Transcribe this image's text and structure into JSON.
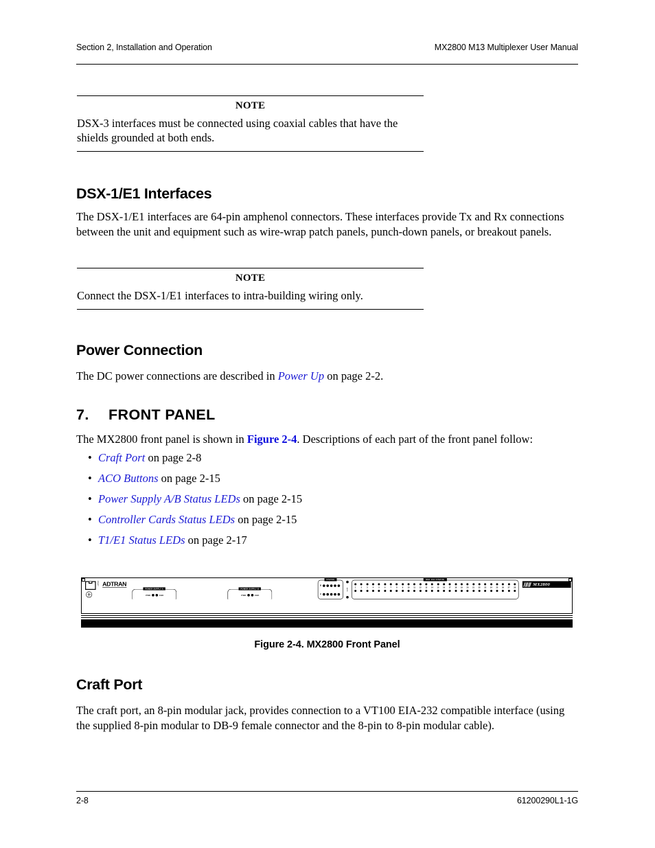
{
  "header": {
    "left": "Section 2, Installation and Operation",
    "right": "MX2800 M13 Multiplexer User Manual"
  },
  "footer": {
    "page_number": "2-8",
    "doc_number": "61200290L1-1G"
  },
  "notes": [
    {
      "title": "NOTE",
      "body": "DSX-3 interfaces must be connected using coaxial cables that have the shields grounded at both ends."
    },
    {
      "title": "NOTE",
      "body": "Connect the DSX-1/E1 interfaces to intra-building wiring only."
    }
  ],
  "sections": {
    "dsx1e1": {
      "heading": "DSX-1/E1 Interfaces",
      "paragraph": "The DSX-1/E1 interfaces are 64-pin amphenol connectors. These interfaces provide Tx and Rx connections between the unit and equipment such as wire-wrap patch panels, punch-down panels, or breakout panels."
    },
    "power_connection": {
      "heading": "Power Connection",
      "para_before_link": "The DC power connections are described in ",
      "link_text": "Power Up",
      "para_after_link": " on page 2-2."
    },
    "front_panel": {
      "number": "7.",
      "heading": "FRONT PANEL",
      "intro_before_link": "The MX2800 front panel is shown in ",
      "intro_link": "Figure 2-4",
      "intro_after_link": ". Descriptions of each part of the front panel follow:",
      "bullets": [
        {
          "link": "Craft Port",
          "rest": " on page 2-8"
        },
        {
          "link": "ACO Buttons",
          "rest": " on page 2-15"
        },
        {
          "link": "Power Supply A/B Status LEDs",
          "rest": " on page 2-15"
        },
        {
          "link": "Controller Cards Status LEDs",
          "rest": " on page 2-15"
        },
        {
          "link": "T1/E1 Status LEDs",
          "rest": " on page 2-17"
        }
      ]
    },
    "craft_port": {
      "heading": "Craft Port",
      "paragraph": "The craft port, an 8-pin modular jack, provides connection to a VT100 EIA-232 compatible interface (using the supplied 8-pin modular to DB-9 female connector and the 8-pin to 8-pin modular cable)."
    }
  },
  "figure": {
    "caption": "Figure 2-4.  MX2800 Front Panel",
    "panel": {
      "craft_label": "CRAFT",
      "brand": "ADTRAN",
      "product_badge": "MX2800",
      "power_supplies": [
        {
          "title": "POWER SUPPLY A",
          "led_left_label": "PWR",
          "led_right_label": "CHK"
        },
        {
          "title": "POWER SUPPLY B",
          "led_left_label": "PWR",
          "led_right_label": "CHK"
        }
      ],
      "status_box": {
        "title": "STATUS",
        "rows": [
          {
            "label": "B",
            "led_count": 5
          },
          {
            "label": "A",
            "led_count": 5
          }
        ]
      },
      "aco_label": "ACO",
      "dsx_box": {
        "title": "DSX 1/E1 STATUS",
        "channels": [
          1,
          2,
          3,
          4,
          5,
          6,
          7,
          8,
          9,
          10,
          11,
          12,
          13,
          14,
          15,
          16,
          17,
          18,
          19,
          20,
          21,
          22,
          23,
          24,
          25,
          26,
          27,
          28
        ]
      }
    }
  },
  "colors": {
    "link": "#1b1bd4",
    "link_bold": "#0c0cdd",
    "text": "#000000",
    "panel_bg": "#ffffff",
    "panel_dark": "#000000"
  }
}
